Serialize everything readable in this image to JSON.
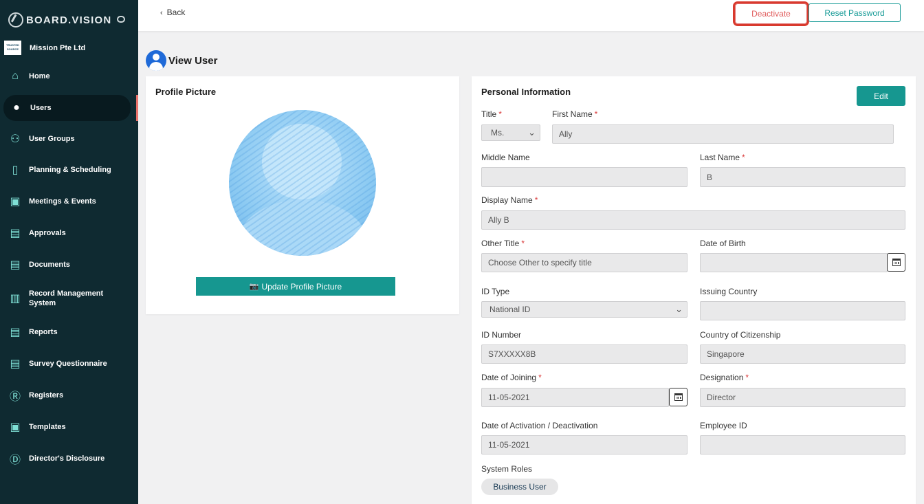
{
  "brand": {
    "name": "BOARD.VISION"
  },
  "org": {
    "logo_text": "TRUSTED SOURCE",
    "name": "Mission Pte Ltd"
  },
  "sidebar": {
    "items": [
      {
        "label": "Home",
        "icon": "home-icon"
      },
      {
        "label": "Users",
        "icon": "user-icon"
      },
      {
        "label": "User Groups",
        "icon": "users-icon"
      },
      {
        "label": "Planning & Scheduling",
        "icon": "bars-icon"
      },
      {
        "label": "Meetings & Events",
        "icon": "calendar-icon"
      },
      {
        "label": "Approvals",
        "icon": "document-icon"
      },
      {
        "label": "Documents",
        "icon": "documents-icon"
      },
      {
        "label": "Record Management System",
        "icon": "records-icon"
      },
      {
        "label": "Reports",
        "icon": "report-icon"
      },
      {
        "label": "Survey Questionnaire",
        "icon": "survey-icon"
      },
      {
        "label": "Registers",
        "icon": "registered-icon"
      },
      {
        "label": "Templates",
        "icon": "template-icon"
      },
      {
        "label": "Director's Disclosure",
        "icon": "disclosure-icon"
      }
    ],
    "active": "Users"
  },
  "topbar": {
    "back_label": "Back",
    "deactivate_label": "Deactivate",
    "reset_label": "Reset Password"
  },
  "page": {
    "title": "View User"
  },
  "profile": {
    "title": "Profile Picture",
    "update_label": "Update Profile Picture"
  },
  "personal": {
    "title": "Personal Information",
    "edit_label": "Edit",
    "fields": {
      "title": {
        "label": "Title",
        "value": "Ms."
      },
      "first_name": {
        "label": "First Name",
        "value": "Ally"
      },
      "middle_name": {
        "label": "Middle Name",
        "value": ""
      },
      "last_name": {
        "label": "Last Name",
        "value": "B"
      },
      "display_name": {
        "label": "Display Name",
        "value": "Ally B"
      },
      "other_title": {
        "label": "Other Title",
        "value": "Choose Other to specify title"
      },
      "dob": {
        "label": "Date of Birth",
        "value": ""
      },
      "id_type": {
        "label": "ID Type",
        "value": "National ID"
      },
      "issuing_country": {
        "label": "Issuing Country",
        "value": ""
      },
      "id_number": {
        "label": "ID Number",
        "value": "S7XXXXX8B"
      },
      "citizenship": {
        "label": "Country of Citizenship",
        "value": "Singapore"
      },
      "joining": {
        "label": "Date of Joining",
        "value": "11-05-2021"
      },
      "designation": {
        "label": "Designation",
        "value": "Director"
      },
      "activation": {
        "label": "Date of Activation / Deactivation",
        "value": "11-05-2021"
      },
      "employee_id": {
        "label": "Employee ID",
        "value": ""
      }
    },
    "system_roles_label": "System Roles",
    "roles": [
      "Business User"
    ],
    "required_mark": "*"
  },
  "colors": {
    "sidebar": "#0f2a31",
    "accent": "#169790",
    "danger": "#d93a2e",
    "icon": "#7fe0d6"
  }
}
